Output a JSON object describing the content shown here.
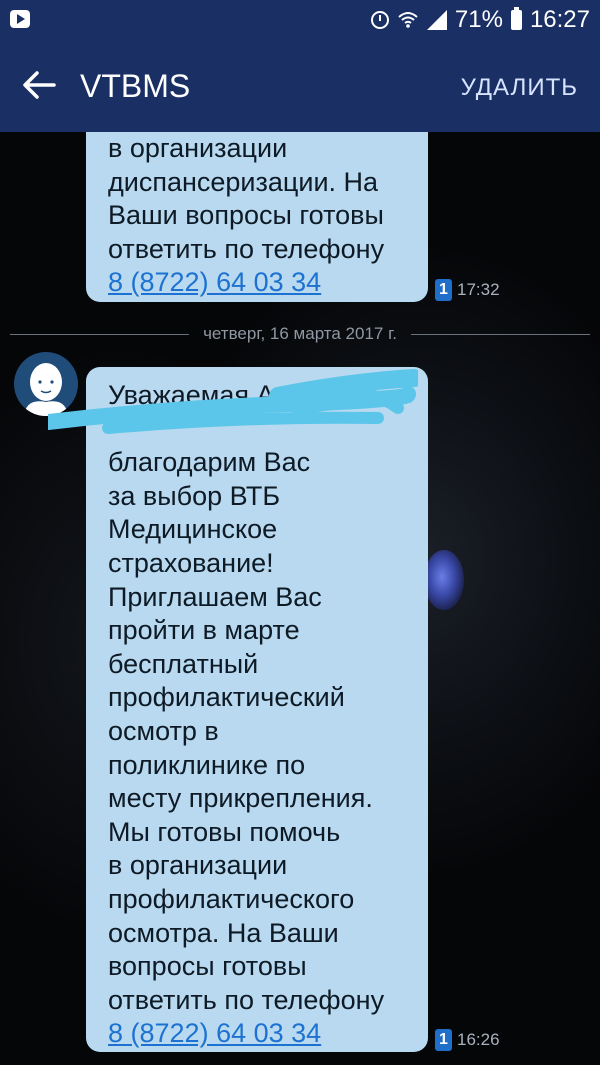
{
  "status_bar": {
    "battery_percent": "71%",
    "time": "16:27",
    "icons": [
      "app-icon",
      "alarm-icon",
      "wifi-icon",
      "signal-icon",
      "battery-icon"
    ]
  },
  "app_bar": {
    "title": "VTBMS",
    "delete_label": "УДАЛИТЬ",
    "color": "#1a2f63"
  },
  "messages": [
    {
      "lines": [
        "в организации",
        "диспансеризации. На",
        "Ваши вопросы готовы",
        "ответить по телефону"
      ],
      "phone": "8 (8722) 64 03 34",
      "sim": "1",
      "time": "17:32"
    },
    {
      "lines": [
        "Уважаемая А",
        "",
        "благодарим Вас",
        "за выбор ВТБ",
        "Медицинское",
        "страхование!",
        "Приглашаем Вас",
        "пройти в марте",
        "бесплатный",
        "профилактический",
        "осмотр в",
        "поликлинике по",
        "месту прикрепления.",
        "Мы готовы помочь",
        "в организации",
        "профилактического",
        "осмотра. На Ваши",
        "вопросы готовы",
        "ответить по телефону"
      ],
      "phone": "8 (8722) 64 03 34",
      "sim": "1",
      "time": "16:26"
    }
  ],
  "date_divider": "четверг, 16 марта 2017 г.",
  "colors": {
    "bubble": "#b8d9ef",
    "link": "#1d72d1",
    "sim_badge": "#1f6ec9"
  }
}
